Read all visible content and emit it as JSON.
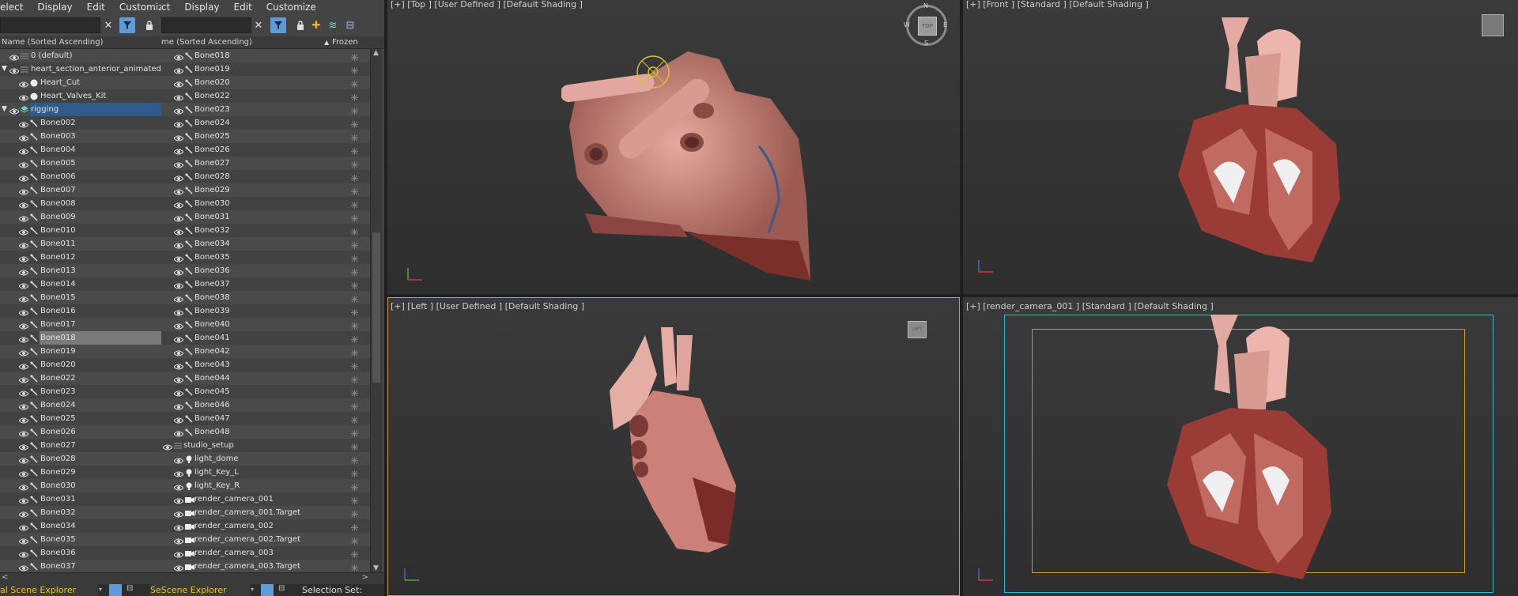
{
  "left_panel": {
    "menu": [
      "elect",
      "Display",
      "Edit",
      "Customize"
    ],
    "column_name": "Name (Sorted Ascending)",
    "rows": [
      {
        "label": "0 (default)",
        "indent": 0,
        "expand": "",
        "icon": "layer",
        "eye": true
      },
      {
        "label": "heart_section_anterior_animated",
        "indent": 0,
        "expand": "v",
        "icon": "layer",
        "eye": true
      },
      {
        "label": "Heart_Cut",
        "indent": 1,
        "expand": "",
        "icon": "sphere",
        "eye": true
      },
      {
        "label": "Heart_Valves_Kit",
        "indent": 1,
        "expand": "",
        "icon": "sphere",
        "eye": true
      },
      {
        "label": "rigging",
        "indent": 0,
        "expand": "v",
        "icon": "layers",
        "eye": true,
        "highlight": true
      },
      {
        "label": "Bone002",
        "indent": 1,
        "icon": "bone",
        "eye": true
      },
      {
        "label": "Bone003",
        "indent": 1,
        "icon": "bone",
        "eye": true
      },
      {
        "label": "Bone004",
        "indent": 1,
        "icon": "bone",
        "eye": true
      },
      {
        "label": "Bone005",
        "indent": 1,
        "icon": "bone",
        "eye": true
      },
      {
        "label": "Bone006",
        "indent": 1,
        "icon": "bone",
        "eye": true
      },
      {
        "label": "Bone007",
        "indent": 1,
        "icon": "bone",
        "eye": true
      },
      {
        "label": "Bone008",
        "indent": 1,
        "icon": "bone",
        "eye": true
      },
      {
        "label": "Bone009",
        "indent": 1,
        "icon": "bone",
        "eye": true
      },
      {
        "label": "Bone010",
        "indent": 1,
        "icon": "bone",
        "eye": true
      },
      {
        "label": "Bone011",
        "indent": 1,
        "icon": "bone",
        "eye": true
      },
      {
        "label": "Bone012",
        "indent": 1,
        "icon": "bone",
        "eye": true
      },
      {
        "label": "Bone013",
        "indent": 1,
        "icon": "bone",
        "eye": true
      },
      {
        "label": "Bone014",
        "indent": 1,
        "icon": "bone",
        "eye": true
      },
      {
        "label": "Bone015",
        "indent": 1,
        "icon": "bone",
        "eye": true
      },
      {
        "label": "Bone016",
        "indent": 1,
        "icon": "bone",
        "eye": true
      },
      {
        "label": "Bone017",
        "indent": 1,
        "icon": "bone",
        "eye": true
      },
      {
        "label": "Bone018",
        "indent": 1,
        "icon": "bone",
        "eye": true,
        "selected": true
      },
      {
        "label": "Bone019",
        "indent": 1,
        "icon": "bone",
        "eye": true
      },
      {
        "label": "Bone020",
        "indent": 1,
        "icon": "bone",
        "eye": true
      },
      {
        "label": "Bone022",
        "indent": 1,
        "icon": "bone",
        "eye": true
      },
      {
        "label": "Bone023",
        "indent": 1,
        "icon": "bone",
        "eye": true
      },
      {
        "label": "Bone024",
        "indent": 1,
        "icon": "bone",
        "eye": true
      },
      {
        "label": "Bone025",
        "indent": 1,
        "icon": "bone",
        "eye": true
      },
      {
        "label": "Bone026",
        "indent": 1,
        "icon": "bone",
        "eye": true
      },
      {
        "label": "Bone027",
        "indent": 1,
        "icon": "bone",
        "eye": true
      },
      {
        "label": "Bone028",
        "indent": 1,
        "icon": "bone",
        "eye": true
      },
      {
        "label": "Bone029",
        "indent": 1,
        "icon": "bone",
        "eye": true
      },
      {
        "label": "Bone030",
        "indent": 1,
        "icon": "bone",
        "eye": true
      },
      {
        "label": "Bone031",
        "indent": 1,
        "icon": "bone",
        "eye": true
      },
      {
        "label": "Bone032",
        "indent": 1,
        "icon": "bone",
        "eye": true
      },
      {
        "label": "Bone034",
        "indent": 1,
        "icon": "bone",
        "eye": true
      },
      {
        "label": "Bone035",
        "indent": 1,
        "icon": "bone",
        "eye": true
      },
      {
        "label": "Bone036",
        "indent": 1,
        "icon": "bone",
        "eye": true
      },
      {
        "label": "Bone037",
        "indent": 1,
        "icon": "bone",
        "eye": true
      }
    ],
    "bottom_tab": "al Scene Explorer"
  },
  "right_panel": {
    "menu": [
      "ct",
      "Display",
      "Edit",
      "Customize"
    ],
    "column_name": "me (Sorted Ascending)",
    "column_frozen": "Frozen",
    "rows": [
      {
        "label": "Bone018",
        "icon": "bone"
      },
      {
        "label": "Bone019",
        "icon": "bone"
      },
      {
        "label": "Bone020",
        "icon": "bone"
      },
      {
        "label": "Bone022",
        "icon": "bone"
      },
      {
        "label": "Bone023",
        "icon": "bone"
      },
      {
        "label": "Bone024",
        "icon": "bone"
      },
      {
        "label": "Bone025",
        "icon": "bone"
      },
      {
        "label": "Bone026",
        "icon": "bone"
      },
      {
        "label": "Bone027",
        "icon": "bone"
      },
      {
        "label": "Bone028",
        "icon": "bone"
      },
      {
        "label": "Bone029",
        "icon": "bone"
      },
      {
        "label": "Bone030",
        "icon": "bone"
      },
      {
        "label": "Bone031",
        "icon": "bone"
      },
      {
        "label": "Bone032",
        "icon": "bone"
      },
      {
        "label": "Bone034",
        "icon": "bone"
      },
      {
        "label": "Bone035",
        "icon": "bone"
      },
      {
        "label": "Bone036",
        "icon": "bone"
      },
      {
        "label": "Bone037",
        "icon": "bone"
      },
      {
        "label": "Bone038",
        "icon": "bone"
      },
      {
        "label": "Bone039",
        "icon": "bone"
      },
      {
        "label": "Bone040",
        "icon": "bone"
      },
      {
        "label": "Bone041",
        "icon": "bone"
      },
      {
        "label": "Bone042",
        "icon": "bone"
      },
      {
        "label": "Bone043",
        "icon": "bone"
      },
      {
        "label": "Bone044",
        "icon": "bone"
      },
      {
        "label": "Bone045",
        "icon": "bone"
      },
      {
        "label": "Bone046",
        "icon": "bone"
      },
      {
        "label": "Bone047",
        "icon": "bone"
      },
      {
        "label": "Bone048",
        "icon": "bone"
      },
      {
        "label": "studio_setup",
        "icon": "layer",
        "top": true
      },
      {
        "label": "light_dome",
        "icon": "light"
      },
      {
        "label": "light_Key_L",
        "icon": "light"
      },
      {
        "label": "light_Key_R",
        "icon": "light"
      },
      {
        "label": "render_camera_001",
        "icon": "camera"
      },
      {
        "label": "render_camera_001.Target",
        "icon": "camera"
      },
      {
        "label": "render_camera_002",
        "icon": "camera"
      },
      {
        "label": "render_camera_002.Target",
        "icon": "camera"
      },
      {
        "label": "render_camera_003",
        "icon": "camera"
      },
      {
        "label": "render_camera_003.Target",
        "icon": "camera"
      }
    ],
    "bottom_tab": "SeScene Explorer",
    "selection_set": "Selection Set:"
  },
  "viewports": {
    "top": "[+] [Top ] [User Defined ] [Default Shading ]",
    "front": "[+] [Front ] [Standard ] [Default Shading ]",
    "left": "[+] [Left ] [User Defined ] [Default Shading ]",
    "camera": "[+] [render_camera_001 ] [Standard ] [Default Shading ]",
    "viewcube_top": "TOP",
    "viewcube_left": "LEFT",
    "compass": {
      "n": "N",
      "s": "S",
      "e": "E",
      "w": "W"
    }
  },
  "colors": {
    "highlight": "#2f5a8f",
    "active_filter": "#5f9bd6",
    "active_viewport_border": "#c9a23a",
    "safe_frame_outer": "#2fb7c9",
    "safe_frame_inner": "#c99a2a"
  }
}
